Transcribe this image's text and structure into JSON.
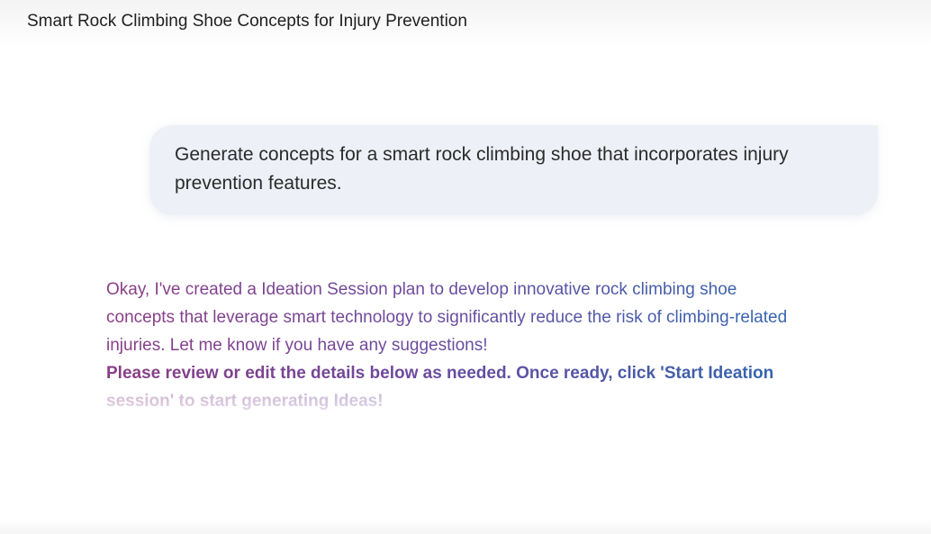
{
  "header": {
    "title": "Smart Rock Climbing Shoe Concepts for Injury Prevention"
  },
  "prompt": {
    "text": "Generate concepts for a smart rock climbing shoe that incorporates injury prevention features."
  },
  "response": {
    "text": "Okay, I've created a Ideation Session plan to develop innovative rock climbing shoe concepts that leverage smart technology to significantly reduce the risk of climbing-related injuries. Let me know if you have any suggestions!",
    "cta": "Please review or edit the details below as needed. Once ready, click 'Start Ideation session' to start generating Ideas!"
  },
  "colors": {
    "accent_start": "#8a3d84",
    "accent_end": "#2f66b0",
    "bubble_bg": "#edf0f7"
  }
}
